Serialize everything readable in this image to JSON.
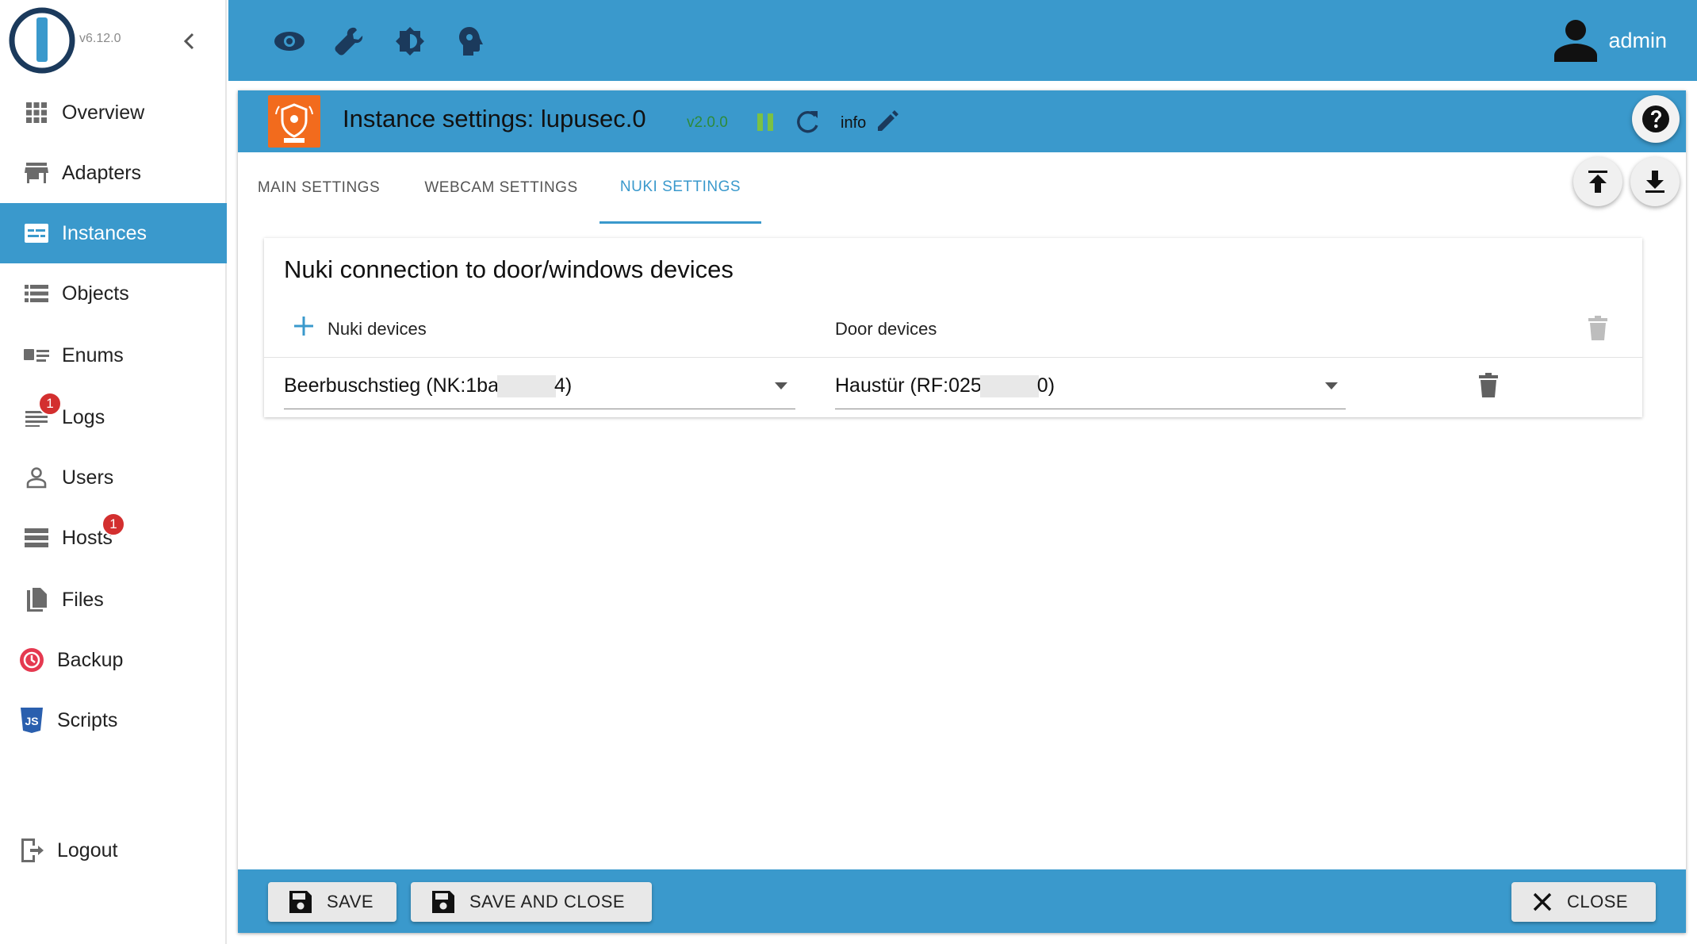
{
  "app": {
    "version": "v6.12.0",
    "user": "admin"
  },
  "sidebar": {
    "items": [
      {
        "label": "Overview"
      },
      {
        "label": "Adapters"
      },
      {
        "label": "Instances"
      },
      {
        "label": "Objects"
      },
      {
        "label": "Enums"
      },
      {
        "label": "Logs",
        "badge": "1"
      },
      {
        "label": "Users"
      },
      {
        "label": "Hosts",
        "badge": "1"
      },
      {
        "label": "Files"
      },
      {
        "label": "Backup"
      },
      {
        "label": "Scripts"
      }
    ],
    "logout": "Logout",
    "active_color": "#3a99cc"
  },
  "instance": {
    "title": "Instance settings: lupusec.0",
    "version": "v2.0.0",
    "info": "info"
  },
  "tabs": [
    {
      "label": "MAIN SETTINGS"
    },
    {
      "label": "WEBCAM SETTINGS"
    },
    {
      "label": "NUKI SETTINGS"
    }
  ],
  "panel": {
    "title": "Nuki connection to door/windows devices",
    "col_nuki": "Nuki devices",
    "col_door": "Door devices",
    "rows": [
      {
        "nuki_prefix": "Beerbuschstieg (NK:1ba",
        "nuki_suffix": "4)",
        "door_prefix": "Haustür (RF:025",
        "door_suffix": "0)"
      }
    ]
  },
  "footer": {
    "save": "SAVE",
    "save_close": "SAVE AND CLOSE",
    "close": "CLOSE"
  },
  "colors": {
    "primary": "#3a99cc",
    "badge": "#d32f2f",
    "adapter_logo": "#f26b1d"
  }
}
